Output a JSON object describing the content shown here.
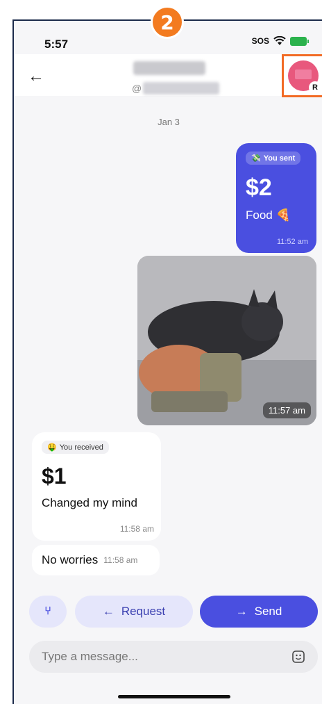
{
  "step_badge": "2",
  "status_bar": {
    "time": "5:57",
    "carrier": "SOS"
  },
  "header": {
    "handle_prefix": "@"
  },
  "avatar": {
    "initial": "R"
  },
  "date_divider": "Jan 3",
  "sent_payment": {
    "pill": "You sent",
    "amount": "$2",
    "note": "Food 🍕",
    "time": "11:52 am"
  },
  "photo_message": {
    "time": "11:57 am"
  },
  "received_payment": {
    "pill": "You received",
    "amount": "$1",
    "note": "Changed my mind",
    "time": "11:58 am"
  },
  "text_message": {
    "text": "No worries",
    "time": "11:58 am"
  },
  "actions": {
    "request_label": "Request",
    "send_label": "Send"
  },
  "composer": {
    "placeholder": "Type a message..."
  },
  "colors": {
    "accent": "#4a4fe0",
    "highlight": "#f26b25",
    "badge": "#f37b20"
  }
}
